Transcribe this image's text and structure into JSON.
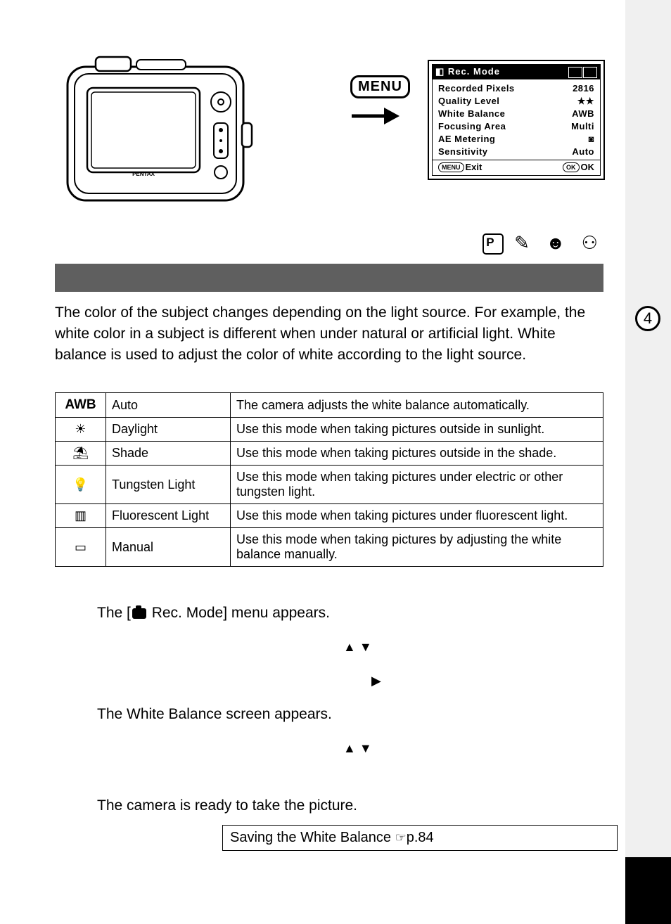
{
  "chapter_tab": "4",
  "menu_button": "MENU",
  "lcd": {
    "title": "Rec. Mode",
    "rows": [
      {
        "label": "Recorded Pixels",
        "value": "2816"
      },
      {
        "label": "Quality Level",
        "value": "★★"
      },
      {
        "label": "White Balance",
        "value": "AWB"
      },
      {
        "label": "Focusing Area",
        "value": "Multi"
      },
      {
        "label": "AE Metering",
        "value": "◙"
      },
      {
        "label": "Sensitivity",
        "value": "Auto"
      }
    ],
    "foot_left_pill": "MENU",
    "foot_left": "Exit",
    "foot_right_pill": "OK",
    "foot_right": "OK"
  },
  "mode_icons": {
    "p": "P",
    "rest": "✎ ☻ ⚇"
  },
  "intro": "The color of the subject changes depending on the light source. For example, the white color in a subject is different when under natural or artificial light. White balance is used to adjust the color of white according to the light source.",
  "table": [
    {
      "icon": "AWB",
      "icon_class": "awb",
      "name": "Auto",
      "desc": "The camera adjusts the white balance automatically."
    },
    {
      "icon": "☀",
      "name": "Daylight",
      "desc": "Use this mode when taking pictures outside in sunlight."
    },
    {
      "icon": "⛱",
      "name": "Shade",
      "desc": "Use this mode when taking pictures outside in the shade."
    },
    {
      "icon": "💡",
      "name": "Tungsten Light",
      "desc": "Use this mode when taking pictures under electric or other tungsten light."
    },
    {
      "icon": "▥",
      "name": "Fluorescent Light",
      "desc": "Use this mode when taking pictures under fluorescent light."
    },
    {
      "icon": "▭",
      "name": "Manual",
      "desc": "Use this mode when taking pictures by adjusting the white balance manually."
    }
  ],
  "steps": {
    "s1b": " Rec. Mode] menu appears.",
    "s1a": "The [",
    "tri_ud": "▲ ▼",
    "tri_r": "▶",
    "s3": "The White Balance screen appears.",
    "s5": "The camera is ready to take the picture."
  },
  "savebox": {
    "text": "Saving the White Balance ",
    "page": "p.84",
    "hand": "☞"
  }
}
